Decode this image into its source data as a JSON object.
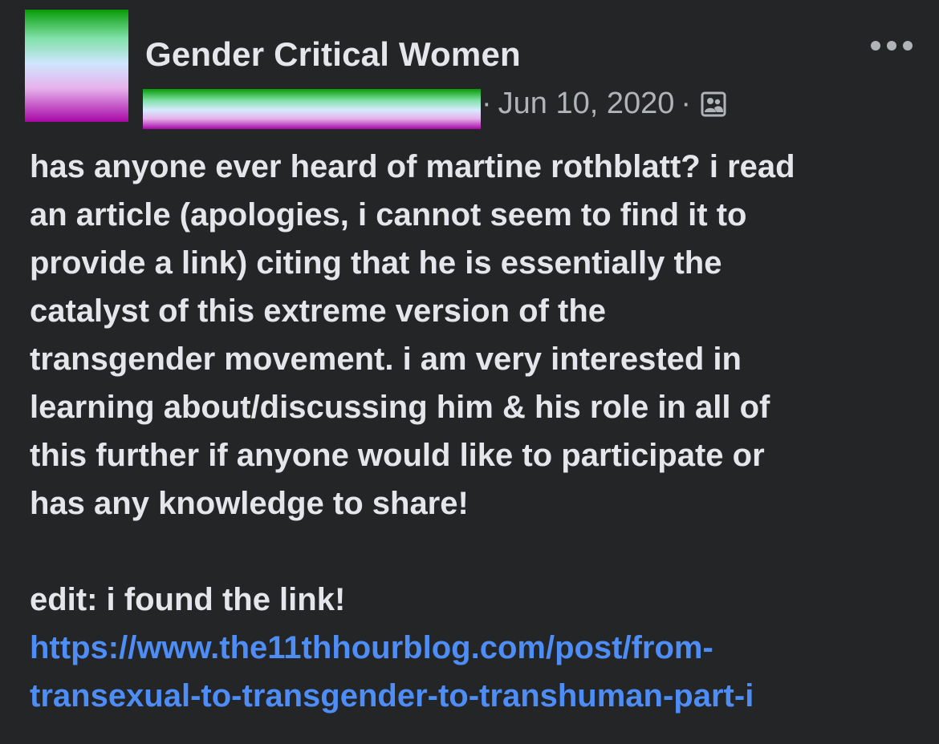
{
  "header": {
    "group_name": "Gender Critical Women",
    "meta_separator": "·",
    "date": "Jun 10, 2020",
    "audience_icon": "members-icon",
    "more_icon": "more-horizontal-icon"
  },
  "colors": {
    "background": "#242526",
    "text_primary": "#e4e6eb",
    "text_secondary": "#b0b3b8",
    "link": "#4e8df5",
    "avatar_gradient": [
      "#079b06",
      "#cfe6ff",
      "#a707a7"
    ]
  },
  "post": {
    "lines": [
      "has anyone ever heard of martine rothblatt? i read",
      "an article (apologies, i cannot seem to find it to",
      "provide a link) citing that he is essentially the",
      "catalyst of this extreme version of the",
      "transgender movement. i am very interested in",
      "learning about/discussing him & his role in all of",
      "this further if anyone would like to participate or",
      "has any knowledge to share!"
    ],
    "edit_line": "edit: i found the link!",
    "link_lines": [
      "https://www.the11thhourblog.com/post/from-",
      "transexual-to-transgender-to-transhuman-part-i"
    ]
  }
}
